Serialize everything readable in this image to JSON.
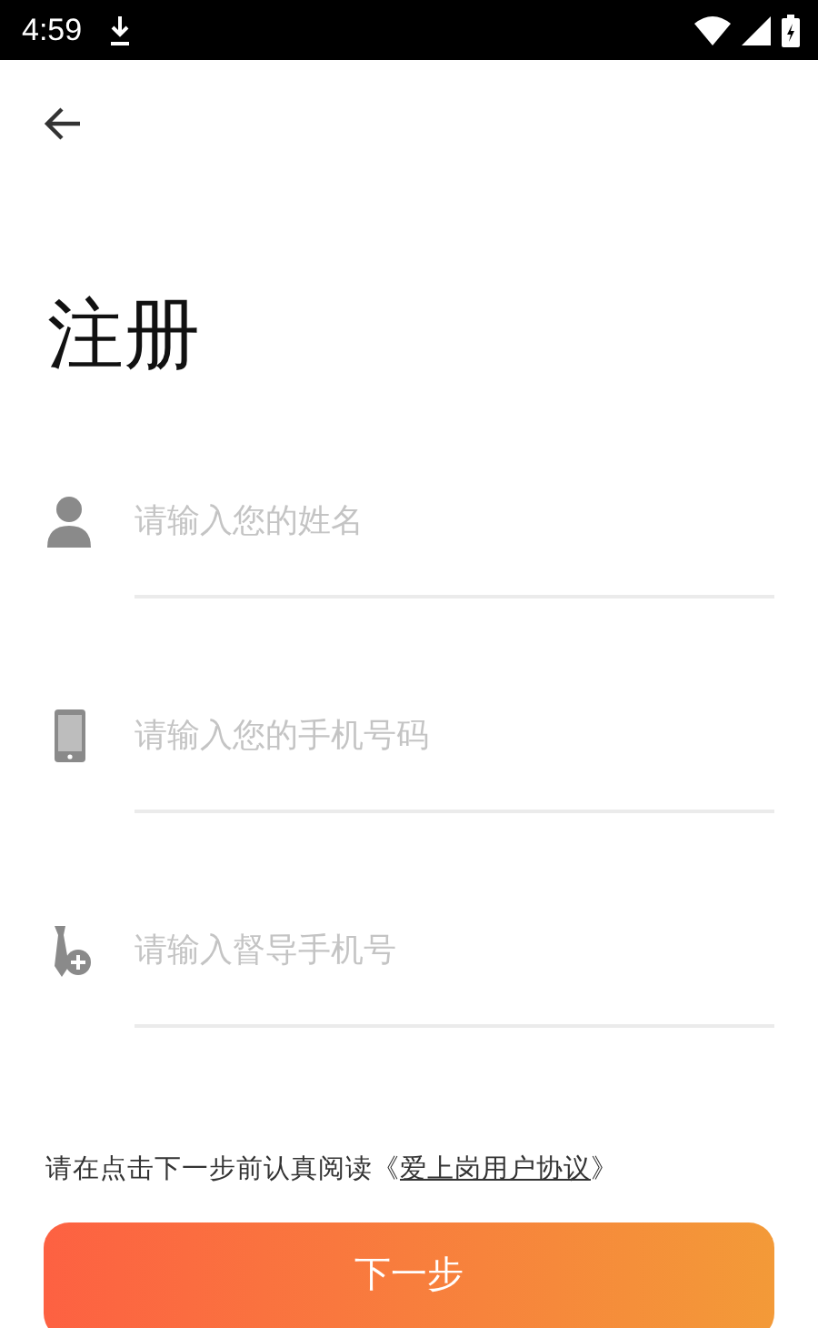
{
  "status_bar": {
    "time": "4:59"
  },
  "title": "注册",
  "fields": [
    {
      "kind": "person",
      "placeholder": "请输入您的姓名"
    },
    {
      "kind": "phone",
      "placeholder": "请输入您的手机号码"
    },
    {
      "kind": "supervisor",
      "placeholder": "请输入督导手机号"
    }
  ],
  "agreement": {
    "prefix": "请在点击下一步前认真阅读《",
    "link": "爱上岗用户协议",
    "suffix": "》"
  },
  "button": "下一步"
}
